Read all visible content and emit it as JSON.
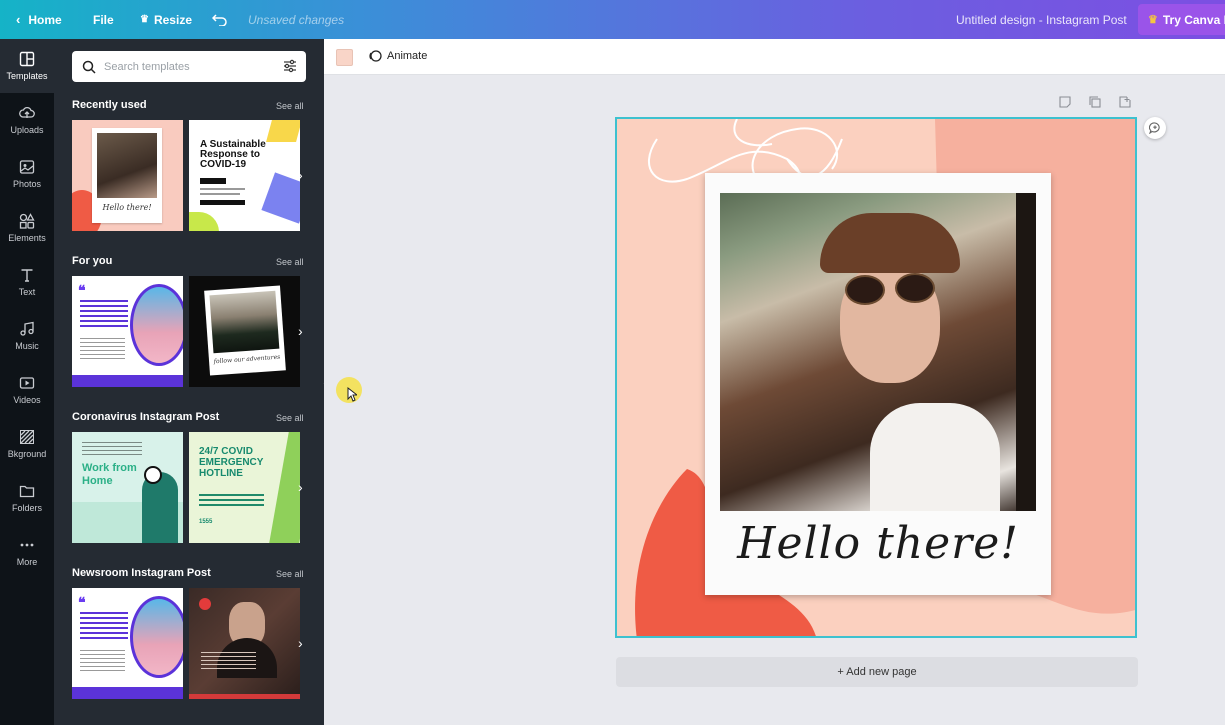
{
  "topbar": {
    "home_label": "Home",
    "file_label": "File",
    "resize_label": "Resize",
    "unsaved_label": "Unsaved changes",
    "doc_title": "Untitled design - Instagram Post",
    "try_label": "Try Canva Pro"
  },
  "rail": [
    {
      "label": "Templates",
      "icon": "templates-icon"
    },
    {
      "label": "Uploads",
      "icon": "uploads-icon"
    },
    {
      "label": "Photos",
      "icon": "photos-icon"
    },
    {
      "label": "Elements",
      "icon": "elements-icon"
    },
    {
      "label": "Text",
      "icon": "text-icon"
    },
    {
      "label": "Music",
      "icon": "music-icon"
    },
    {
      "label": "Videos",
      "icon": "videos-icon"
    },
    {
      "label": "Bkground",
      "icon": "background-icon"
    },
    {
      "label": "Folders",
      "icon": "folders-icon"
    },
    {
      "label": "More",
      "icon": "more-icon"
    }
  ],
  "search": {
    "placeholder": "Search templates"
  },
  "sections": [
    {
      "title": "Recently used",
      "see_all": "See all"
    },
    {
      "title": "For you",
      "see_all": "See all"
    },
    {
      "title": "Coronavirus Instagram Post",
      "see_all": "See all"
    },
    {
      "title": "Newsroom Instagram Post",
      "see_all": "See all"
    }
  ],
  "thumbs": {
    "hello_caption": "Hello there!",
    "covid_title": "A Sustainable Response to COVID-19",
    "work_home": "Work from Home",
    "hotline": "24/7 COVID EMERGENCY HOTLINE",
    "hotline_number": "1555",
    "follow_caption": "follow our adventures"
  },
  "toolbar": {
    "animate_label": "Animate"
  },
  "canvas": {
    "caption": "Hello there!",
    "add_page": "+ Add new page"
  },
  "colors": {
    "accent": "#3dc1cf",
    "peach": "#fbd0bf",
    "coral": "#ef5b45"
  }
}
